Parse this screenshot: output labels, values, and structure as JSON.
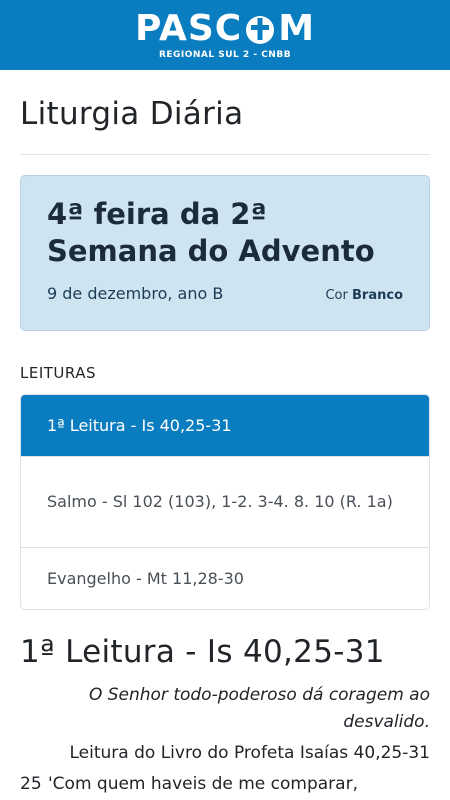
{
  "header": {
    "logo_text_left": "PASC",
    "logo_text_right": "M",
    "logo_subtitle": "REGIONAL SUL 2 - CNBB"
  },
  "page": {
    "title": "Liturgia Diária"
  },
  "day": {
    "title": "4ª feira da 2ª Semana do Advento",
    "date": "9 de dezembro, ano B",
    "color_label": "Cor",
    "color_value": "Branco"
  },
  "readings": {
    "section_label": "LEITURAS",
    "items": [
      {
        "label": "1ª Leitura - Is 40,25-31",
        "active": true
      },
      {
        "label": "Salmo - Sl 102 (103), 1-2. 3-4. 8. 10 (R. 1a)",
        "active": false
      },
      {
        "label": "Evangelho - Mt 11,28-30",
        "active": false
      }
    ]
  },
  "current_reading": {
    "heading": "1ª Leitura - Is 40,25-31",
    "subtitle": "O Senhor todo-poderoso dá coragem ao desvalido.",
    "intro": "Leitura do Livro do Profeta Isaías 40,25-31",
    "verse_number": "25",
    "verse_text": "'Com quem haveis de me comparar,"
  },
  "colors": {
    "brand_blue": "#0a7dc0",
    "card_bg": "#cfe4f1"
  }
}
